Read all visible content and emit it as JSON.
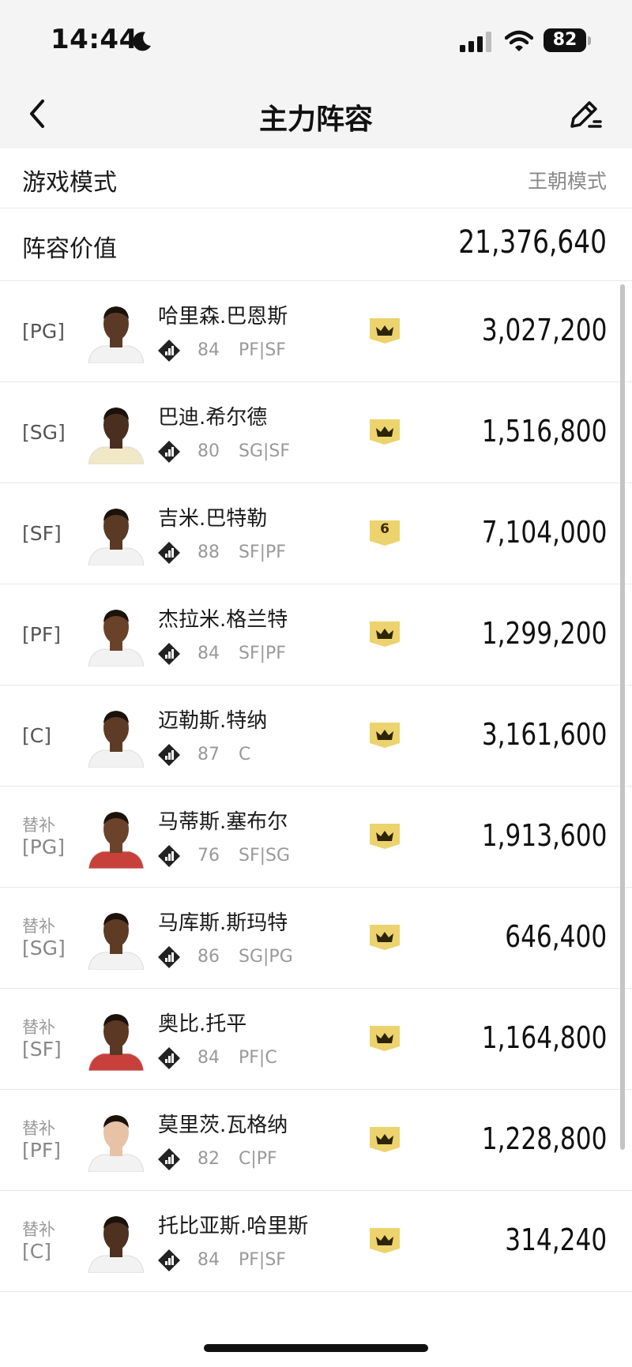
{
  "status_bar": {
    "time": "14:44",
    "battery": "82"
  },
  "nav": {
    "title": "主力阵容",
    "back_icon": "chevron-left-icon",
    "edit_icon": "edit-pencil-icon"
  },
  "game_mode": {
    "label": "游戏模式",
    "value": "王朝模式"
  },
  "lineup_value": {
    "label": "阵容价值",
    "value": "21,376,640"
  },
  "colors": {
    "badge": "#ecd36d",
    "rating_icon": "#222222"
  },
  "players": [
    {
      "sub": "",
      "pos": "[PG]",
      "name": "哈里森.巴恩斯",
      "rating": "84",
      "positions": "PF|SF",
      "badge": "crown",
      "badge_text": "",
      "value": "3,027,200",
      "skin": "#5a3a26",
      "jersey": "#f2f2f2"
    },
    {
      "sub": "",
      "pos": "[SG]",
      "name": "巴迪.希尔德",
      "rating": "80",
      "positions": "SG|SF",
      "badge": "crown",
      "badge_text": "",
      "value": "1,516,800",
      "skin": "#4a2f20",
      "jersey": "#f1e8c8"
    },
    {
      "sub": "",
      "pos": "[SF]",
      "name": "吉米.巴特勒",
      "rating": "88",
      "positions": "SF|PF",
      "badge": "number",
      "badge_text": "6",
      "value": "7,104,000",
      "skin": "#5b3a25",
      "jersey": "#f2f2f2"
    },
    {
      "sub": "",
      "pos": "[PF]",
      "name": "杰拉米.格兰特",
      "rating": "84",
      "positions": "SF|PF",
      "badge": "crown",
      "badge_text": "",
      "value": "1,299,200",
      "skin": "#6a4229",
      "jersey": "#f2f2f2"
    },
    {
      "sub": "",
      "pos": "[C]",
      "name": "迈勒斯.特纳",
      "rating": "87",
      "positions": "C",
      "badge": "crown",
      "badge_text": "",
      "value": "3,161,600",
      "skin": "#5d3b26",
      "jersey": "#f2f2f2"
    },
    {
      "sub": "替补",
      "pos": "[PG]",
      "name": "马蒂斯.塞布尔",
      "rating": "76",
      "positions": "SF|SG",
      "badge": "crown",
      "badge_text": "",
      "value": "1,913,600",
      "skin": "#6b432a",
      "jersey": "#c8403a"
    },
    {
      "sub": "替补",
      "pos": "[SG]",
      "name": "马库斯.斯玛特",
      "rating": "86",
      "positions": "SG|PG",
      "badge": "crown",
      "badge_text": "",
      "value": "646,400",
      "skin": "#5e3b25",
      "jersey": "#f2f2f2"
    },
    {
      "sub": "替补",
      "pos": "[SF]",
      "name": "奥比.托平",
      "rating": "84",
      "positions": "PF|C",
      "badge": "crown",
      "badge_text": "",
      "value": "1,164,800",
      "skin": "#5a3824",
      "jersey": "#c8403a"
    },
    {
      "sub": "替补",
      "pos": "[PF]",
      "name": "莫里茨.瓦格纳",
      "rating": "82",
      "positions": "C|PF",
      "badge": "crown",
      "badge_text": "",
      "value": "1,228,800",
      "skin": "#e7c2a4",
      "jersey": "#f2f2f2"
    },
    {
      "sub": "替补",
      "pos": "[C]",
      "name": "托比亚斯.哈里斯",
      "rating": "84",
      "positions": "PF|SF",
      "badge": "crown",
      "badge_text": "",
      "value": "314,240",
      "skin": "#4e3120",
      "jersey": "#f2f2f2"
    }
  ]
}
